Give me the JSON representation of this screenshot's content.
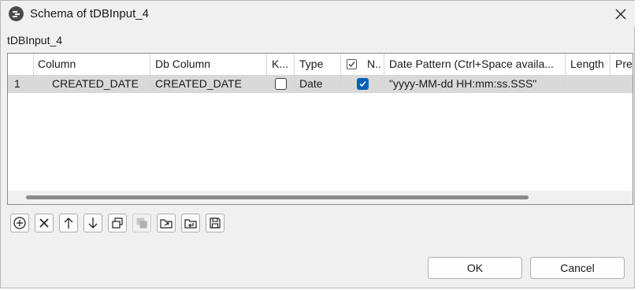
{
  "window": {
    "title": "Schema of tDBInput_4",
    "close_glyph": "✕"
  },
  "component_label": "tDBInput_4",
  "table": {
    "columns": [
      {
        "label": ""
      },
      {
        "label": "Column"
      },
      {
        "label": "Db Column"
      },
      {
        "label": "K..."
      },
      {
        "label": "Type"
      },
      {
        "label": ""
      },
      {
        "label": "N.."
      },
      {
        "label": "Date Pattern (Ctrl+Space availa..."
      },
      {
        "label": "Length"
      },
      {
        "label": "Pre"
      }
    ],
    "rows": [
      {
        "index": "1",
        "column": "CREATED_DATE",
        "db_column": "CREATED_DATE",
        "key": false,
        "type": "Date",
        "nullable": true,
        "date_pattern": "\"yyyy-MM-dd HH:mm:ss.SSS\"",
        "length": "",
        "precision": ""
      }
    ],
    "header_checkbox": "checked-box-icon"
  },
  "toolbar": {
    "buttons": [
      {
        "icon": "add-icon",
        "enabled": true
      },
      {
        "icon": "remove-icon",
        "enabled": true
      },
      {
        "icon": "move-up-icon",
        "enabled": true
      },
      {
        "icon": "move-down-icon",
        "enabled": true
      },
      {
        "icon": "copy-icon",
        "enabled": true
      },
      {
        "icon": "paste-icon",
        "enabled": false
      },
      {
        "icon": "import-icon",
        "enabled": true
      },
      {
        "icon": "export-icon",
        "enabled": true
      },
      {
        "icon": "save-icon",
        "enabled": true
      }
    ]
  },
  "buttons": {
    "ok": "OK",
    "cancel": "Cancel"
  },
  "colors": {
    "checkbox_checked": "#005fb8",
    "selected_row": "#d9d9d9",
    "dialog_bg": "#f0f0f0"
  }
}
